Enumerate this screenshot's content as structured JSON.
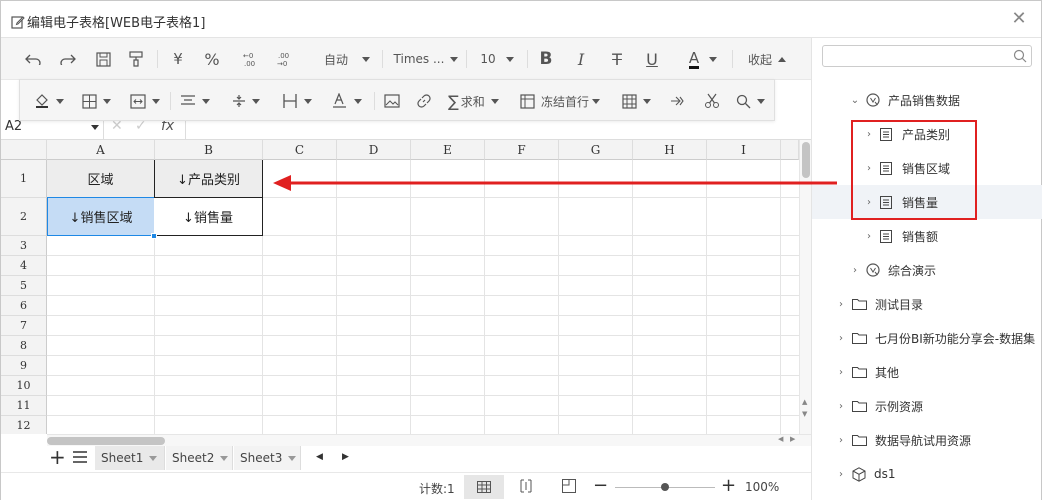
{
  "window": {
    "title": "编辑电子表格[WEB电子表格1]"
  },
  "toolbar1": {
    "currency": "¥",
    "percent": "%",
    "auto_label": "自动",
    "font_name": "Times ...",
    "font_size": "10",
    "bold": "B",
    "italic": "I",
    "strike": "T",
    "underline": "U",
    "font_color": "A",
    "collapse_label": "收起"
  },
  "toolbar2": {
    "sum_label": "求和",
    "freeze_label": "冻结首行",
    "sigma": "∑"
  },
  "formula_bar": {
    "cell_ref": "A2",
    "fx": "fx"
  },
  "sheet": {
    "columns": [
      "A",
      "B",
      "C",
      "D",
      "E",
      "F",
      "G",
      "H",
      "I"
    ],
    "rows": [
      "1",
      "2",
      "3",
      "4",
      "5",
      "6",
      "7",
      "8",
      "9",
      "10",
      "11",
      "12"
    ],
    "cells": {
      "A1": "区域",
      "B1": "↓产品类别",
      "A2": "↓销售区域",
      "B2": "↓销售量"
    }
  },
  "sheet_tabs": [
    "Sheet1",
    "Sheet2",
    "Sheet3"
  ],
  "status": {
    "count": "计数:1",
    "zoom": "100%",
    "zoom_level": 0.5
  },
  "tree": {
    "search_placeholder": "",
    "items": [
      {
        "label": "产品销售数据",
        "icon": "dataset-icon"
      },
      {
        "label": "产品类别",
        "icon": "table-icon"
      },
      {
        "label": "销售区域",
        "icon": "table-icon"
      },
      {
        "label": "销售量",
        "icon": "table-icon"
      },
      {
        "label": "销售额",
        "icon": "table-icon"
      },
      {
        "label": "综合演示",
        "icon": "dataset-icon"
      },
      {
        "label": "测试目录",
        "icon": "folder-icon"
      },
      {
        "label": "七月份BI新功能分享会-数据集",
        "icon": "folder-icon"
      },
      {
        "label": "其他",
        "icon": "folder-icon"
      },
      {
        "label": "示例资源",
        "icon": "folder-icon"
      },
      {
        "label": "数据导航试用资源",
        "icon": "folder-icon"
      },
      {
        "label": "ds1",
        "icon": "cube-icon"
      }
    ]
  },
  "colors": {
    "accent": "#1e88e5",
    "selected_cell": "#c5dcf5",
    "annotation": "#e02020"
  }
}
